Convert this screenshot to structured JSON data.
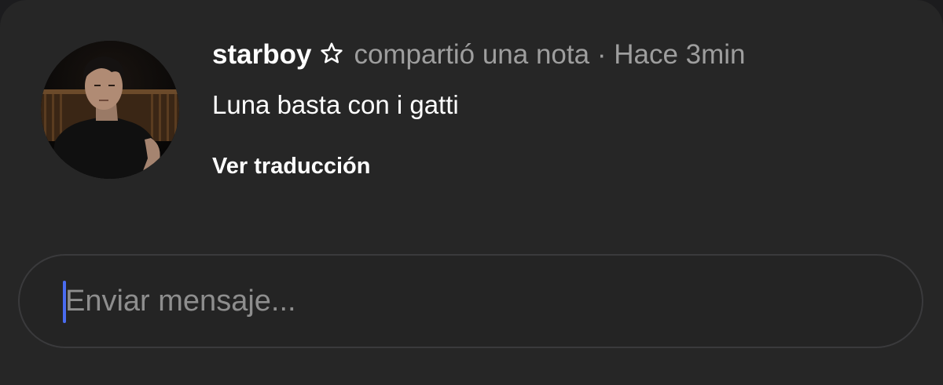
{
  "note": {
    "username": "starboy",
    "badge_icon": "star-outline-icon",
    "action_text": "compartió una nota",
    "separator": "·",
    "timestamp": "Hace 3min",
    "text": "Luna basta con i gatti",
    "translate_label": "Ver traducción",
    "avatar": "profile-photo"
  },
  "composer": {
    "placeholder": "Enviar mensaje...",
    "value": "",
    "caret_color": "#4a6cf0"
  },
  "colors": {
    "background": "#262626",
    "primary_text": "#ffffff",
    "secondary_text": "#9e9e9e"
  }
}
